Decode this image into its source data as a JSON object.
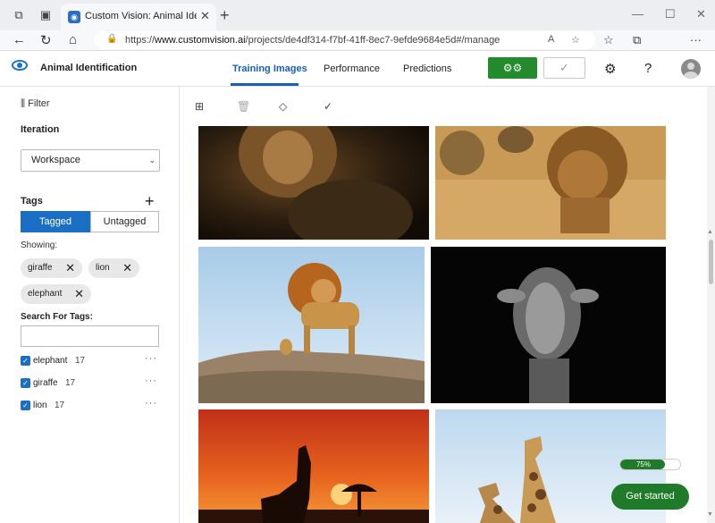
{
  "browser": {
    "tab_title": "Custom Vision: Animal Identificati",
    "url_prefix": "https://",
    "url_host": "www.customvision.ai",
    "url_path": "/projects/de4df314-f7bf-41ff-8ec7-9efde9684e5d#/manage"
  },
  "app": {
    "project_name": "Animal Identification",
    "nav": [
      "Training Images",
      "Performance",
      "Predictions"
    ],
    "active_nav": "Training Images"
  },
  "sidebar": {
    "filter_label": "Filter",
    "iteration_title": "Iteration",
    "iteration_value": "Workspace",
    "tags_title": "Tags",
    "tagged_label": "Tagged",
    "untagged_label": "Untagged",
    "showing_label": "Showing:",
    "chips": [
      "giraffe",
      "lion",
      "elephant"
    ],
    "search_label": "Search For Tags:",
    "search_value": "",
    "tag_list": [
      {
        "name": "elephant",
        "count": "17"
      },
      {
        "name": "giraffe",
        "count": "17"
      },
      {
        "name": "lion",
        "count": "17"
      }
    ]
  },
  "progress": {
    "text": "75%",
    "value": 0.75
  },
  "get_started_label": "Get started",
  "colors": {
    "accent": "#1a6fc4",
    "green": "#238b2b"
  }
}
